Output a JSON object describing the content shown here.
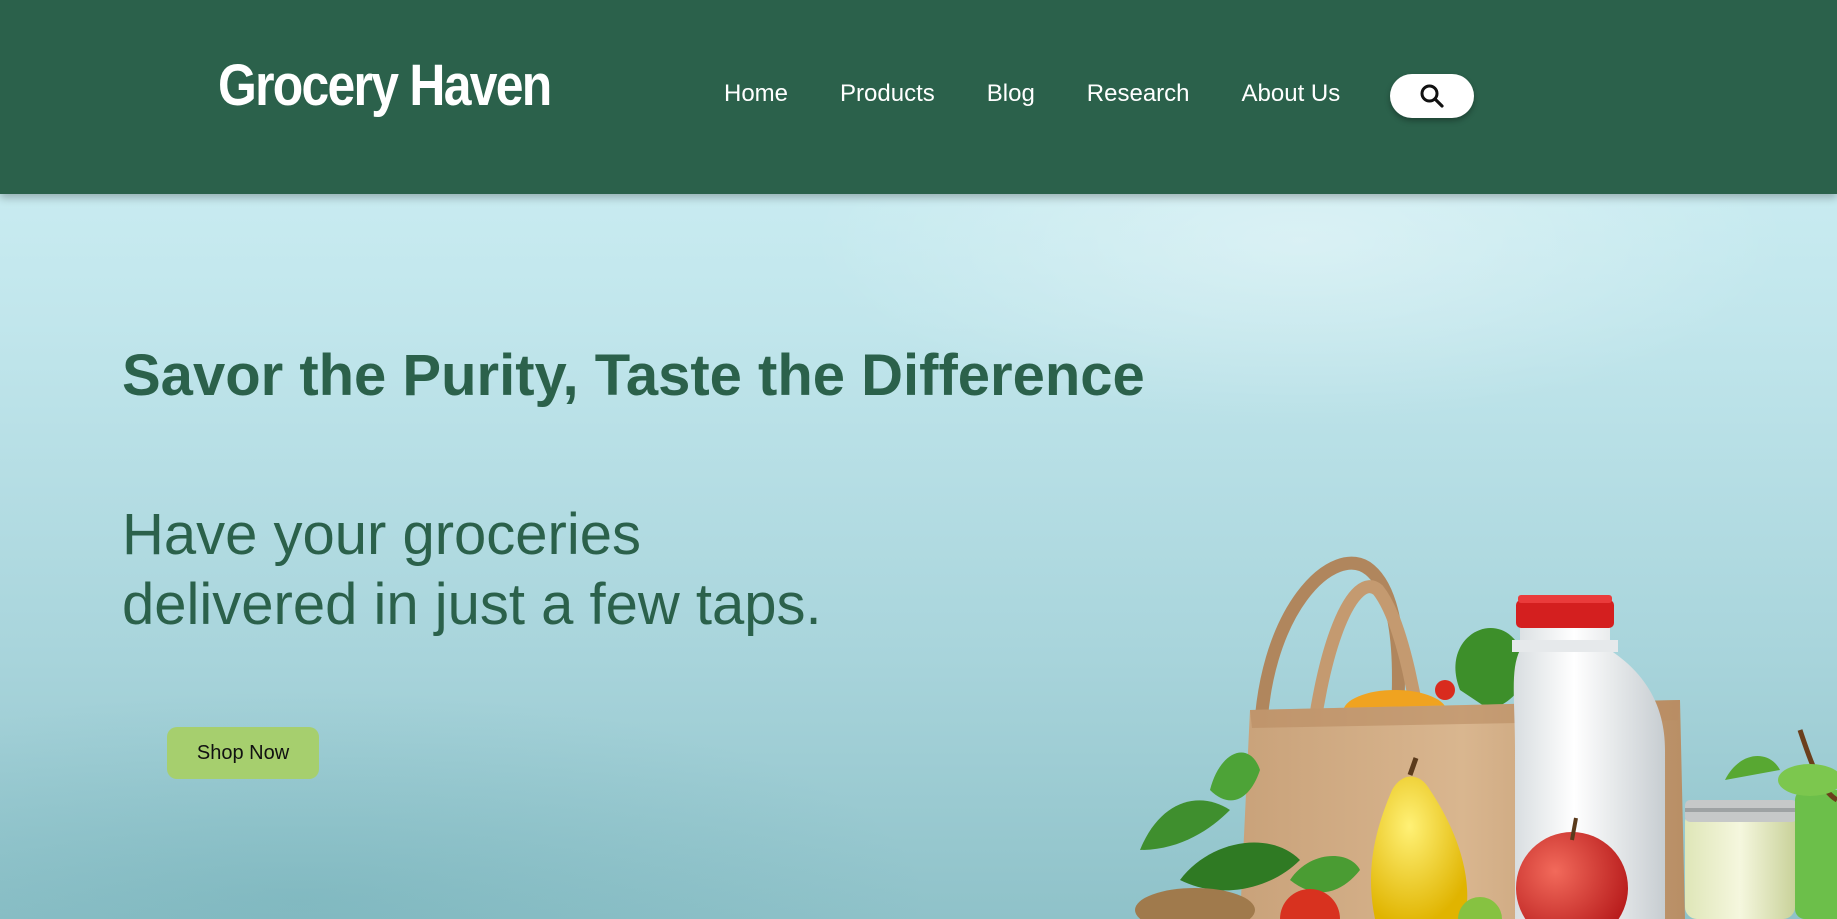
{
  "header": {
    "logo_text": "Grocery Haven",
    "nav": [
      {
        "label": "Home"
      },
      {
        "label": "Products"
      },
      {
        "label": "Blog"
      },
      {
        "label": "Research"
      },
      {
        "label": "About Us"
      }
    ],
    "search_icon": "search-icon"
  },
  "hero": {
    "headline": "Savor the Purity, Taste the Difference",
    "subhead_line1": "Have your groceries",
    "subhead_line2": "delivered in just a few taps.",
    "cta_label": "Shop Now",
    "image_icon": "grocery-bag-illustration"
  },
  "colors": {
    "brand_green": "#2b614b",
    "cta_green": "#a6cf6e",
    "hero_bg": "#c1e6ec"
  }
}
